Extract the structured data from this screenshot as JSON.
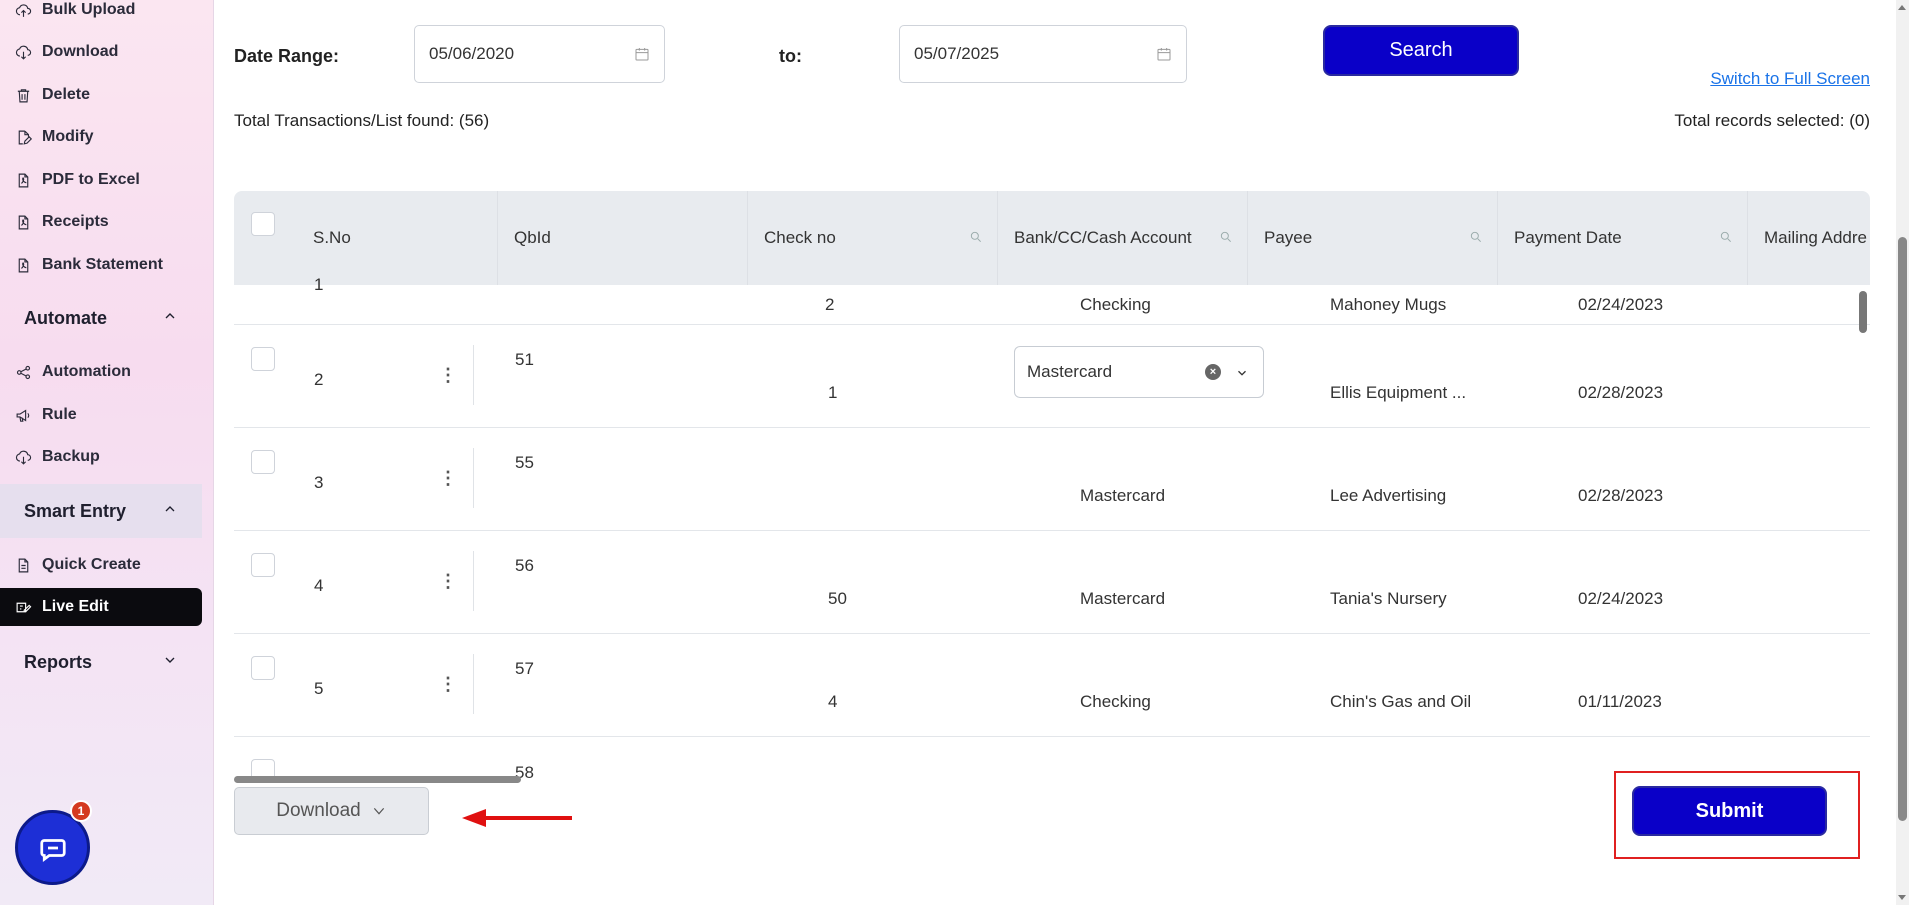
{
  "sidebar": {
    "items_top": [
      {
        "label": "Bulk Upload",
        "icon": "upload-cloud-icon"
      },
      {
        "label": "Download",
        "icon": "download-cloud-icon"
      },
      {
        "label": "Delete",
        "icon": "trash-icon"
      },
      {
        "label": "Modify",
        "icon": "edit-file-icon"
      },
      {
        "label": "PDF to Excel",
        "icon": "pdf-file-icon"
      },
      {
        "label": "Receipts",
        "icon": "receipt-icon"
      },
      {
        "label": "Bank Statement",
        "icon": "statement-icon"
      }
    ],
    "automate": {
      "label": "Automate",
      "items": [
        {
          "label": "Automation",
          "icon": "share-nodes-icon"
        },
        {
          "label": "Rule",
          "icon": "megaphone-icon"
        },
        {
          "label": "Backup",
          "icon": "cloud-backup-icon"
        }
      ]
    },
    "smart_entry": {
      "label": "Smart Entry",
      "items": [
        {
          "label": "Quick Create",
          "icon": "document-icon"
        },
        {
          "label": "Live Edit",
          "icon": "live-edit-icon"
        }
      ]
    },
    "reports": {
      "label": "Reports"
    },
    "chat_badge": "1"
  },
  "filters": {
    "date_range_label": "Date Range:",
    "from_date": "05/06/2020",
    "to_label": "to:",
    "to_date": "05/07/2025",
    "search_label": "Search",
    "full_screen_link": "Switch to Full Screen"
  },
  "summary": {
    "total_found": "Total Transactions/List found: (56)",
    "total_selected": "Total records selected: (0)"
  },
  "table": {
    "columns": [
      "S.No",
      "QbId",
      "Check no",
      "Bank/CC/Cash Account",
      "Payee",
      "Payment Date",
      "Mailing Addre"
    ],
    "partial_top_row": {
      "sno": "1",
      "qbid": "",
      "check_no": "2",
      "account": "Checking",
      "payee": "Mahoney Mugs",
      "date": "02/24/2023"
    },
    "rows": [
      {
        "sno": "2",
        "qbid": "51",
        "check_no": "1",
        "account": "Mastercard",
        "payee": "Ellis Equipment ...",
        "date": "02/28/2023"
      },
      {
        "sno": "3",
        "qbid": "55",
        "check_no": "",
        "account": "Mastercard",
        "payee": "Lee Advertising",
        "date": "02/28/2023"
      },
      {
        "sno": "4",
        "qbid": "56",
        "check_no": "50",
        "account": "Mastercard",
        "payee": "Tania's Nursery",
        "date": "02/24/2023"
      },
      {
        "sno": "5",
        "qbid": "57",
        "check_no": "4",
        "account": "Checking",
        "payee": "Chin's Gas and Oil",
        "date": "01/11/2023"
      }
    ],
    "partial_bottom_qbid": "58",
    "editing_select_value": "Mastercard"
  },
  "footer": {
    "download_label": "Download",
    "submit_label": "Submit"
  },
  "colors": {
    "primary": "#0a00c8",
    "highlight": "#e02020",
    "link": "#1a73e8"
  }
}
